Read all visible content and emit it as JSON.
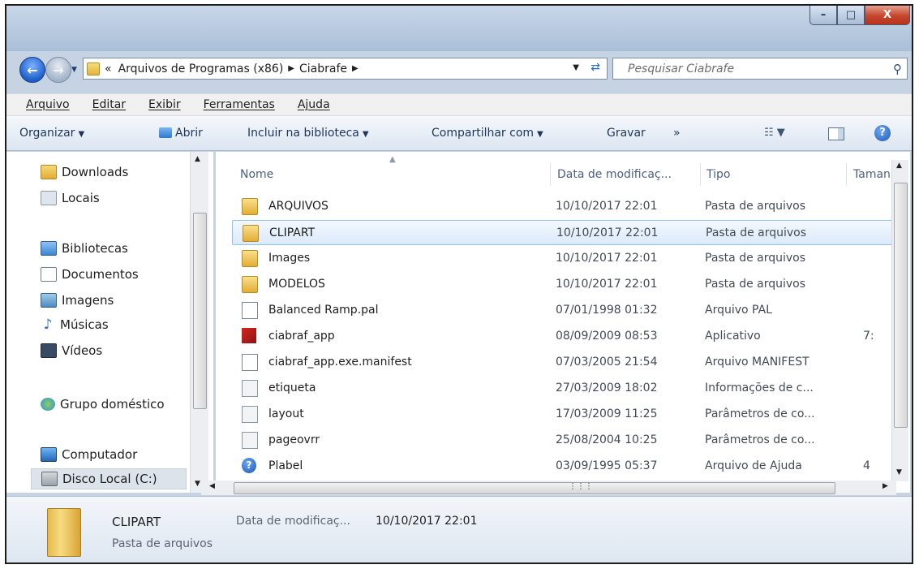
{
  "window": {
    "caption": {
      "minimize": "–",
      "maximize": "□",
      "close": "X"
    }
  },
  "address": {
    "prefix": "«",
    "segments": [
      "Arquivos de Programas (x86)",
      "Ciabrafe"
    ],
    "separator": "▶"
  },
  "search": {
    "placeholder": "Pesquisar Ciabrafe"
  },
  "menu": [
    "Arquivo",
    "Editar",
    "Exibir",
    "Ferramentas",
    "Ajuda"
  ],
  "toolbar": {
    "organize": "Organizar",
    "open": "Abrir",
    "include": "Incluir na biblioteca",
    "share": "Compartilhar com",
    "burn": "Gravar",
    "more": "»"
  },
  "nav": {
    "items": [
      "Downloads",
      "Locais",
      "Bibliotecas",
      "Documentos",
      "Imagens",
      "Músicas",
      "Vídeos",
      "Grupo doméstico",
      "Computador",
      "Disco Local (C:)"
    ]
  },
  "columns": {
    "name": "Nome",
    "date": "Data de modificaç...",
    "type": "Tipo",
    "size": "Tamanl"
  },
  "files": [
    {
      "name": "ARQUIVOS",
      "date": "10/10/2017 22:01",
      "type": "Pasta de arquivos",
      "size": "",
      "icon": "folder"
    },
    {
      "name": "CLIPART",
      "date": "10/10/2017 22:01",
      "type": "Pasta de arquivos",
      "size": "",
      "icon": "folder"
    },
    {
      "name": "Images",
      "date": "10/10/2017 22:01",
      "type": "Pasta de arquivos",
      "size": "",
      "icon": "folder"
    },
    {
      "name": "MODELOS",
      "date": "10/10/2017 22:01",
      "type": "Pasta de arquivos",
      "size": "",
      "icon": "folder"
    },
    {
      "name": "Balanced Ramp.pal",
      "date": "07/01/1998 01:32",
      "type": "Arquivo PAL",
      "size": "",
      "icon": "document"
    },
    {
      "name": "ciabraf_app",
      "date": "08/09/2009 08:53",
      "type": "Aplicativo",
      "size": "7:",
      "icon": "app"
    },
    {
      "name": "ciabraf_app.exe.manifest",
      "date": "07/03/2005 21:54",
      "type": "Arquivo MANIFEST",
      "size": "",
      "icon": "document"
    },
    {
      "name": "etiqueta",
      "date": "27/03/2009 18:02",
      "type": "Informações de c...",
      "size": "",
      "icon": "config"
    },
    {
      "name": "layout",
      "date": "17/03/2009 11:25",
      "type": "Parâmetros de co...",
      "size": "",
      "icon": "config"
    },
    {
      "name": "pageovrr",
      "date": "25/08/2004 10:25",
      "type": "Parâmetros de co...",
      "size": "",
      "icon": "config"
    },
    {
      "name": "Plabel",
      "date": "03/09/1995 05:37",
      "type": "Arquivo de Ajuda",
      "size": "4",
      "icon": "help"
    }
  ],
  "details": {
    "name": "CLIPART",
    "type": "Pasta de arquivos",
    "date_label": "Data de modificaç...",
    "date_value": "10/10/2017 22:01"
  },
  "colors": {
    "selection": "#dceafb",
    "selection_border": "#8ec3f3",
    "toolbar_text": "#1e3557"
  }
}
